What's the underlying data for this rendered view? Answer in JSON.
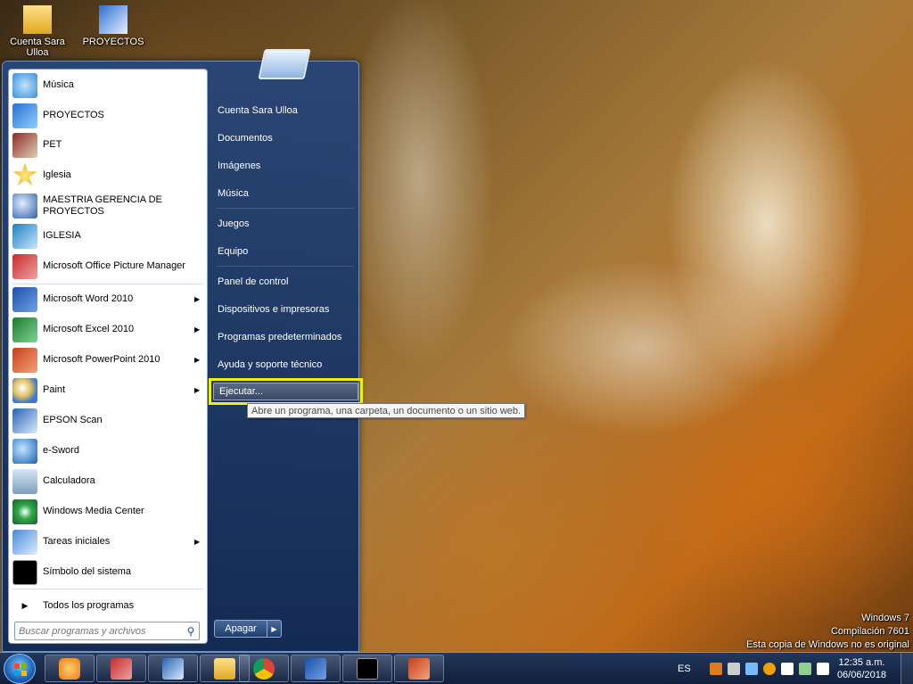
{
  "desktop": {
    "icons": [
      {
        "label": "Cuenta Sara Ulloa",
        "icon": "user-folder-icon"
      },
      {
        "label": "PROYECTOS",
        "icon": "project-shortcut-icon"
      }
    ],
    "watermark": {
      "line1": "Windows 7",
      "line2": "Compilación 7601",
      "line3": "Esta copia de Windows no es original"
    }
  },
  "start_menu": {
    "programs": [
      {
        "label": "Música",
        "icon": "music-icon"
      },
      {
        "label": "PROYECTOS",
        "icon": "projects-icon"
      },
      {
        "label": "PET",
        "icon": "pet-icon"
      },
      {
        "label": "Iglesia",
        "icon": "star-icon"
      },
      {
        "label": "MAESTRIA GERENCIA DE PROYECTOS",
        "icon": "globe-icon"
      },
      {
        "label": "IGLESIA",
        "icon": "iglesia-icon"
      },
      {
        "label": "Microsoft Office Picture Manager",
        "icon": "picture-manager-icon"
      },
      {
        "label": "Microsoft Word 2010",
        "icon": "word-icon"
      },
      {
        "label": "Microsoft Excel 2010",
        "icon": "excel-icon"
      },
      {
        "label": "Microsoft PowerPoint 2010",
        "icon": "powerpoint-icon"
      },
      {
        "label": "Paint",
        "icon": "paint-icon"
      },
      {
        "label": "EPSON Scan",
        "icon": "scanner-icon"
      },
      {
        "label": "e-Sword",
        "icon": "esword-icon"
      },
      {
        "label": "Calculadora",
        "icon": "calculator-icon"
      },
      {
        "label": "Windows Media Center",
        "icon": "media-center-icon"
      },
      {
        "label": "Tareas iniciales",
        "icon": "getting-started-icon"
      },
      {
        "label": "Símbolo del sistema",
        "icon": "command-prompt-icon"
      }
    ],
    "all_programs": "Todos los programas",
    "search_placeholder": "Buscar programas y archivos",
    "right": [
      "Cuenta Sara Ulloa",
      "Documentos",
      "Imágenes",
      "Música",
      "Juegos",
      "Equipo",
      "Panel de control",
      "Dispositivos e impresoras",
      "Programas predeterminados",
      "Ayuda y soporte técnico"
    ],
    "run": "Ejecutar...",
    "run_tooltip": "Abre un programa, una carpeta, un documento o un sitio web.",
    "shutdown": "Apagar"
  },
  "taskbar": {
    "language": "ES",
    "time": "12:35 a.m.",
    "date": "06/06/2018",
    "pinned": [
      "media-player-icon",
      "picture-manager-icon",
      "snipping-tool-icon",
      "explorer-folder-icon",
      "chrome-icon",
      "word-icon",
      "command-prompt-icon",
      "powerpoint-icon"
    ]
  },
  "colors": {
    "highlight_box": "#f3f000",
    "menu_blue": "#1f3f70"
  }
}
